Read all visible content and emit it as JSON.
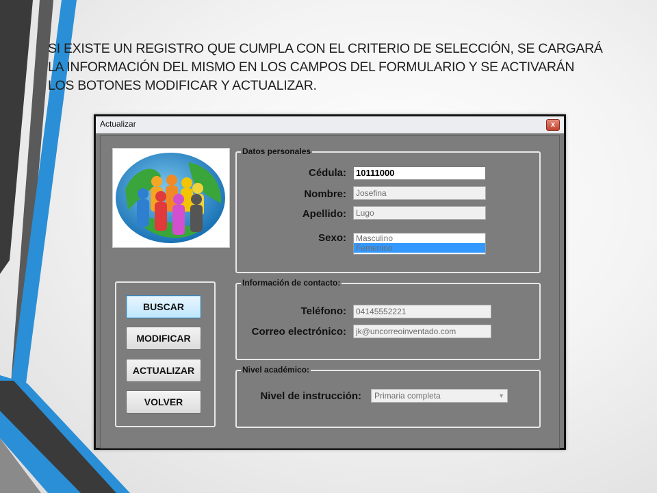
{
  "slide": {
    "headline_lines": [
      "SI EXISTE UN REGISTRO QUE CUMPLA CON EL CRITERIO DE SELECCIÓN, SE CARGARÁ",
      "LA INFORMACIÓN DEL MISMO EN LOS CAMPOS DEL FORMULARIO Y SE ACTIVARÁN",
      "LOS BOTONES MODIFICAR Y ACTUALIZAR."
    ]
  },
  "window": {
    "title": "Actualizar",
    "close_glyph": "x",
    "logo_icon": "people-globe-icon"
  },
  "datos_personales": {
    "title": "Datos personales",
    "cedula_label": "Cédula:",
    "cedula_value": "10111000",
    "nombre_label": "Nombre:",
    "nombre_value": "Josefina",
    "apellido_label": "Apellido:",
    "apellido_value": "Lugo",
    "sexo_label": "Sexo:",
    "sexo_options": [
      "Masculino",
      "Femenino"
    ],
    "sexo_selected": "Femenino"
  },
  "buttons": {
    "buscar": "BUSCAR",
    "modificar": "MODIFICAR",
    "actualizar": "ACTUALIZAR",
    "volver": "VOLVER"
  },
  "contacto": {
    "title": "Información de contacto:",
    "telefono_label": "Teléfono:",
    "telefono_value": "04145552221",
    "correo_label": "Correo electrónico:",
    "correo_value": "jk@uncorreoinventado.com"
  },
  "academico": {
    "title": "Nivel académico:",
    "nivel_label": "Nivel de instrucción:",
    "nivel_value": "Primaria completa"
  },
  "colors": {
    "accent_blue": "#2a8fd6",
    "dark_band": "#3a3a3a",
    "selection_blue": "#3399ff"
  }
}
